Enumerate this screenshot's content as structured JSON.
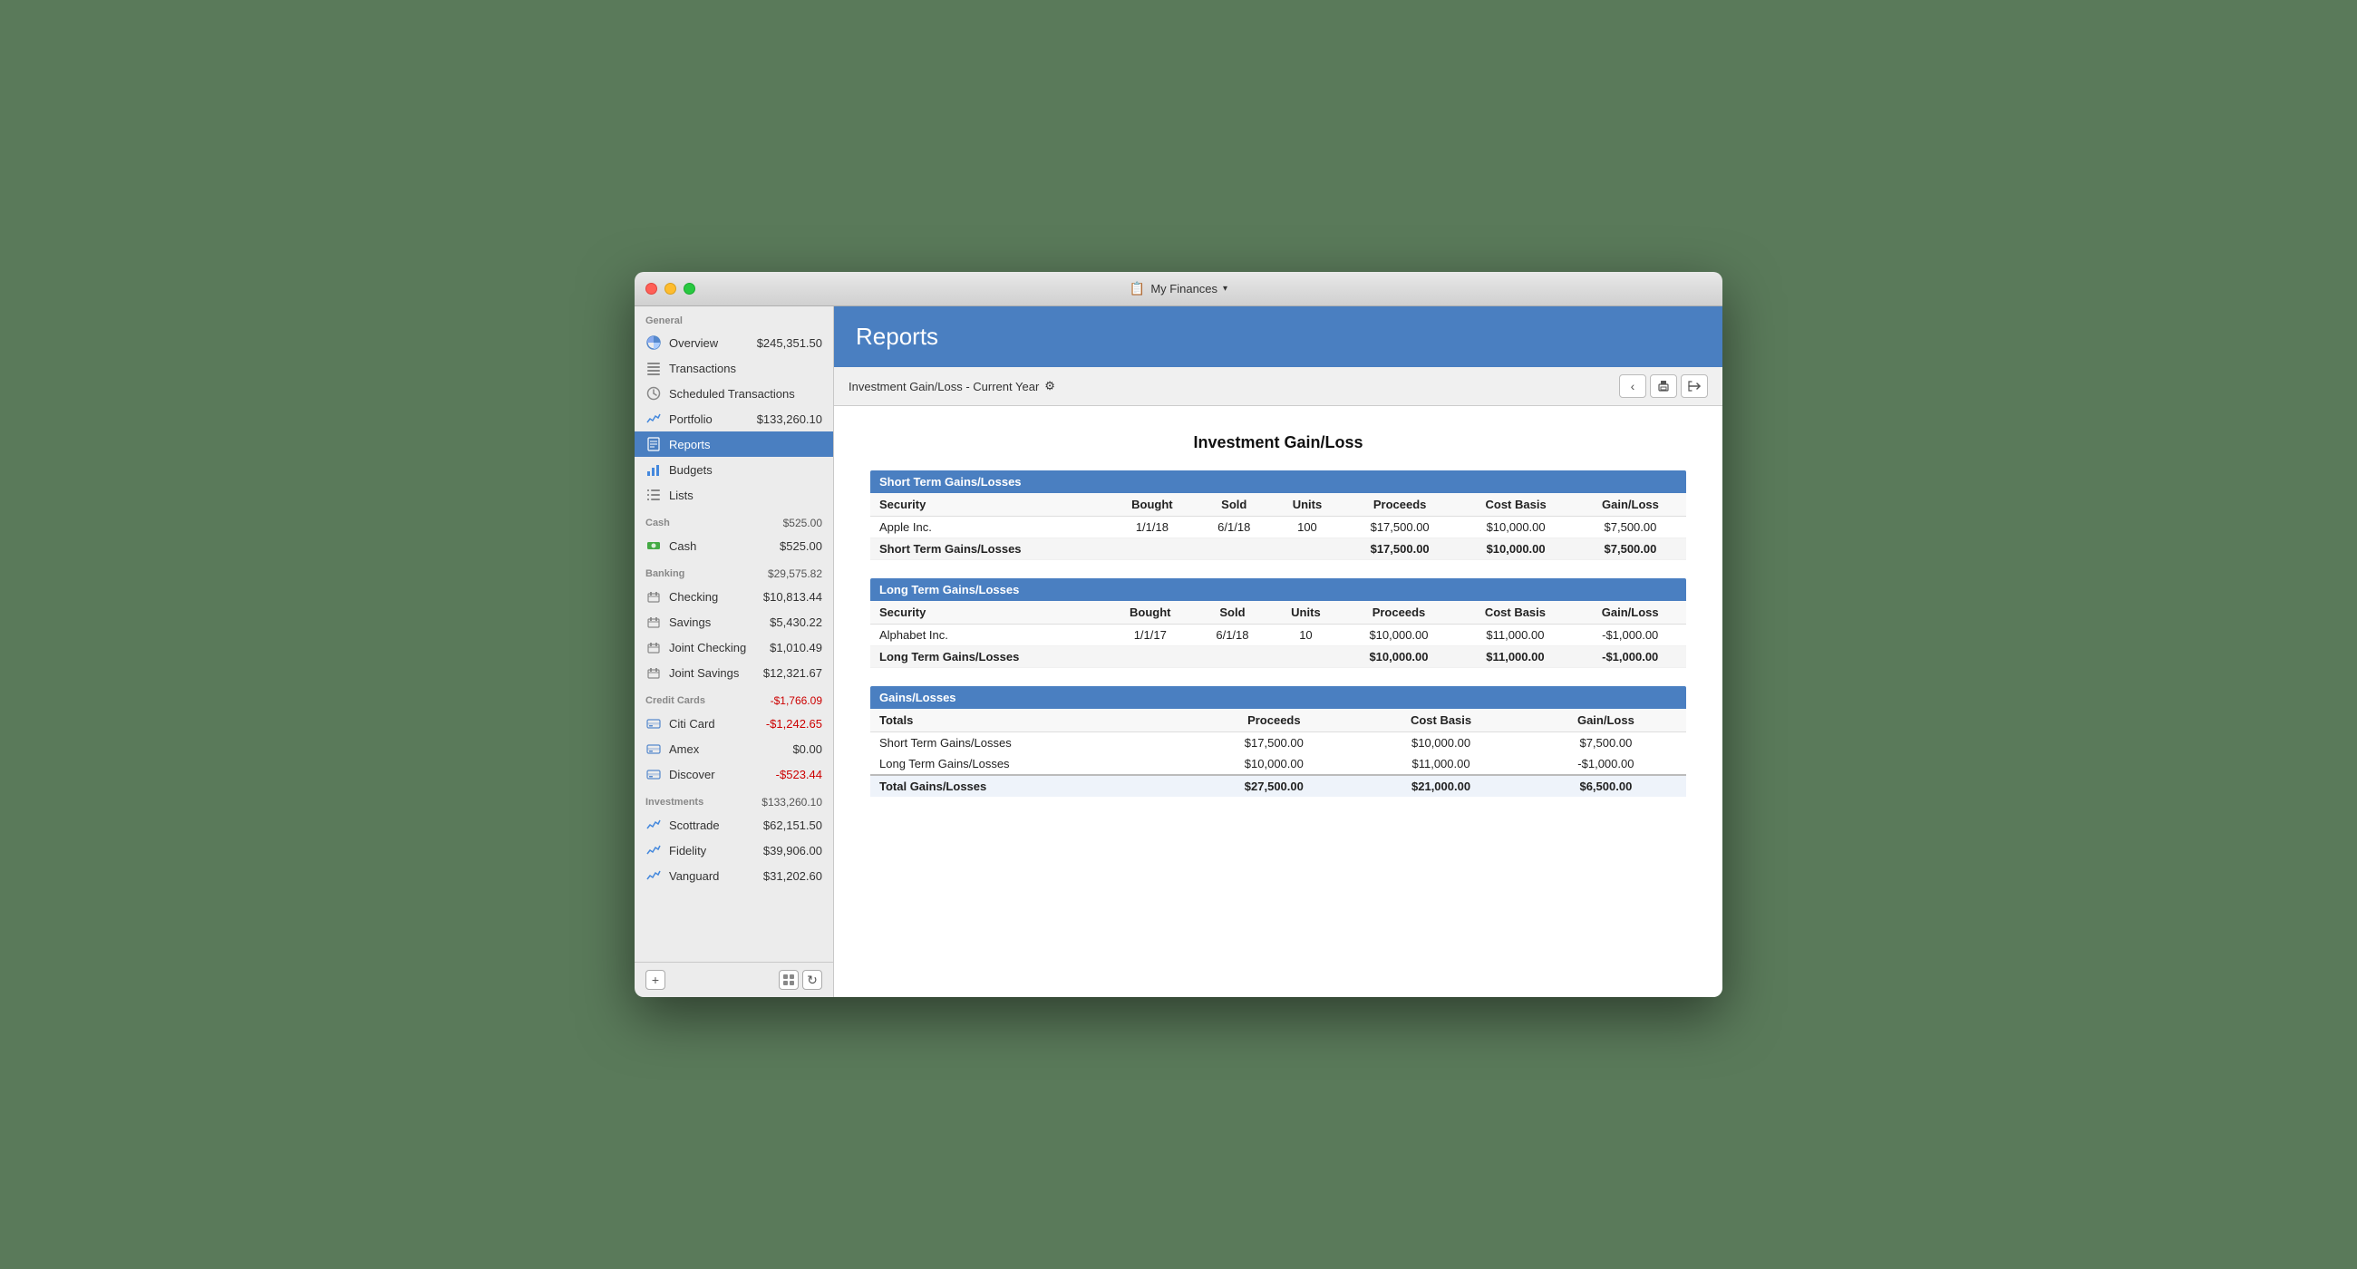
{
  "window": {
    "title": "My Finances",
    "title_icon": "📋"
  },
  "sidebar": {
    "general_label": "General",
    "items_general": [
      {
        "id": "overview",
        "label": "Overview",
        "amount": "$245,351.50",
        "icon": "pie"
      },
      {
        "id": "transactions",
        "label": "Transactions",
        "amount": "",
        "icon": "list"
      },
      {
        "id": "scheduled",
        "label": "Scheduled Transactions",
        "amount": "",
        "icon": "clock"
      },
      {
        "id": "portfolio",
        "label": "Portfolio",
        "amount": "$133,260.10",
        "icon": "chart"
      },
      {
        "id": "reports",
        "label": "Reports",
        "amount": "",
        "icon": "doc",
        "active": true
      },
      {
        "id": "budgets",
        "label": "Budgets",
        "amount": "",
        "icon": "bar"
      },
      {
        "id": "lists",
        "label": "Lists",
        "amount": "",
        "icon": "listlines"
      }
    ],
    "cash_label": "Cash",
    "cash_amount": "$525.00",
    "items_cash": [
      {
        "id": "cash",
        "label": "Cash",
        "amount": "$525.00",
        "icon": "cash"
      }
    ],
    "banking_label": "Banking",
    "banking_amount": "$29,575.82",
    "items_banking": [
      {
        "id": "checking",
        "label": "Checking",
        "amount": "$10,813.44",
        "icon": "bank"
      },
      {
        "id": "savings",
        "label": "Savings",
        "amount": "$5,430.22",
        "icon": "bank"
      },
      {
        "id": "joint-checking",
        "label": "Joint Checking",
        "amount": "$1,010.49",
        "icon": "bank"
      },
      {
        "id": "joint-savings",
        "label": "Joint Savings",
        "amount": "$12,321.67",
        "icon": "bank"
      }
    ],
    "cc_label": "Credit Cards",
    "cc_amount": "-$1,766.09",
    "items_cc": [
      {
        "id": "citi",
        "label": "Citi Card",
        "amount": "-$1,242.65",
        "icon": "cc"
      },
      {
        "id": "amex",
        "label": "Amex",
        "amount": "$0.00",
        "icon": "cc"
      },
      {
        "id": "discover",
        "label": "Discover",
        "amount": "-$523.44",
        "icon": "cc"
      }
    ],
    "invest_label": "Investments",
    "invest_amount": "$133,260.10",
    "items_invest": [
      {
        "id": "scottrade",
        "label": "Scottrade",
        "amount": "$62,151.50",
        "icon": "invest"
      },
      {
        "id": "fidelity",
        "label": "Fidelity",
        "amount": "$39,906.00",
        "icon": "invest"
      },
      {
        "id": "vanguard",
        "label": "Vanguard",
        "amount": "$31,202.60",
        "icon": "invest"
      }
    ],
    "add_btn": "+",
    "refresh_btn": "↻"
  },
  "reports": {
    "header_title": "Reports",
    "report_name": "Investment Gain/Loss - Current Year",
    "settings_icon": "⚙",
    "back_btn": "‹",
    "print_btn": "🖨",
    "export_btn": "↗",
    "doc_title": "Investment Gain/Loss",
    "short_term": {
      "section_label": "Short Term Gains/Losses",
      "columns": [
        "Security",
        "Bought",
        "Sold",
        "Units",
        "Proceeds",
        "Cost Basis",
        "Gain/Loss"
      ],
      "rows": [
        {
          "security": "Apple Inc.",
          "bought": "1/1/18",
          "sold": "6/1/18",
          "units": "100",
          "proceeds": "$17,500.00",
          "cost_basis": "$10,000.00",
          "gain_loss": "$7,500.00"
        }
      ],
      "subtotal_label": "Short Term Gains/Losses",
      "subtotal_proceeds": "$17,500.00",
      "subtotal_cost": "$10,000.00",
      "subtotal_gain": "$7,500.00"
    },
    "long_term": {
      "section_label": "Long Term Gains/Losses",
      "columns": [
        "Security",
        "Bought",
        "Sold",
        "Units",
        "Proceeds",
        "Cost Basis",
        "Gain/Loss"
      ],
      "rows": [
        {
          "security": "Alphabet Inc.",
          "bought": "1/1/17",
          "sold": "6/1/18",
          "units": "10",
          "proceeds": "$10,000.00",
          "cost_basis": "$11,000.00",
          "gain_loss": "-$1,000.00"
        }
      ],
      "subtotal_label": "Long Term Gains/Losses",
      "subtotal_proceeds": "$10,000.00",
      "subtotal_cost": "$11,000.00",
      "subtotal_gain": "-$1,000.00"
    },
    "gains_losses": {
      "section_label": "Gains/Losses",
      "columns": [
        "Totals",
        "Proceeds",
        "Cost Basis",
        "Gain/Loss"
      ],
      "rows": [
        {
          "label": "Short Term Gains/Losses",
          "proceeds": "$17,500.00",
          "cost_basis": "$10,000.00",
          "gain_loss": "$7,500.00"
        },
        {
          "label": "Long Term Gains/Losses",
          "proceeds": "$10,000.00",
          "cost_basis": "$11,000.00",
          "gain_loss": "-$1,000.00"
        }
      ],
      "total_label": "Total Gains/Losses",
      "total_proceeds": "$27,500.00",
      "total_cost": "$21,000.00",
      "total_gain": "$6,500.00"
    }
  }
}
